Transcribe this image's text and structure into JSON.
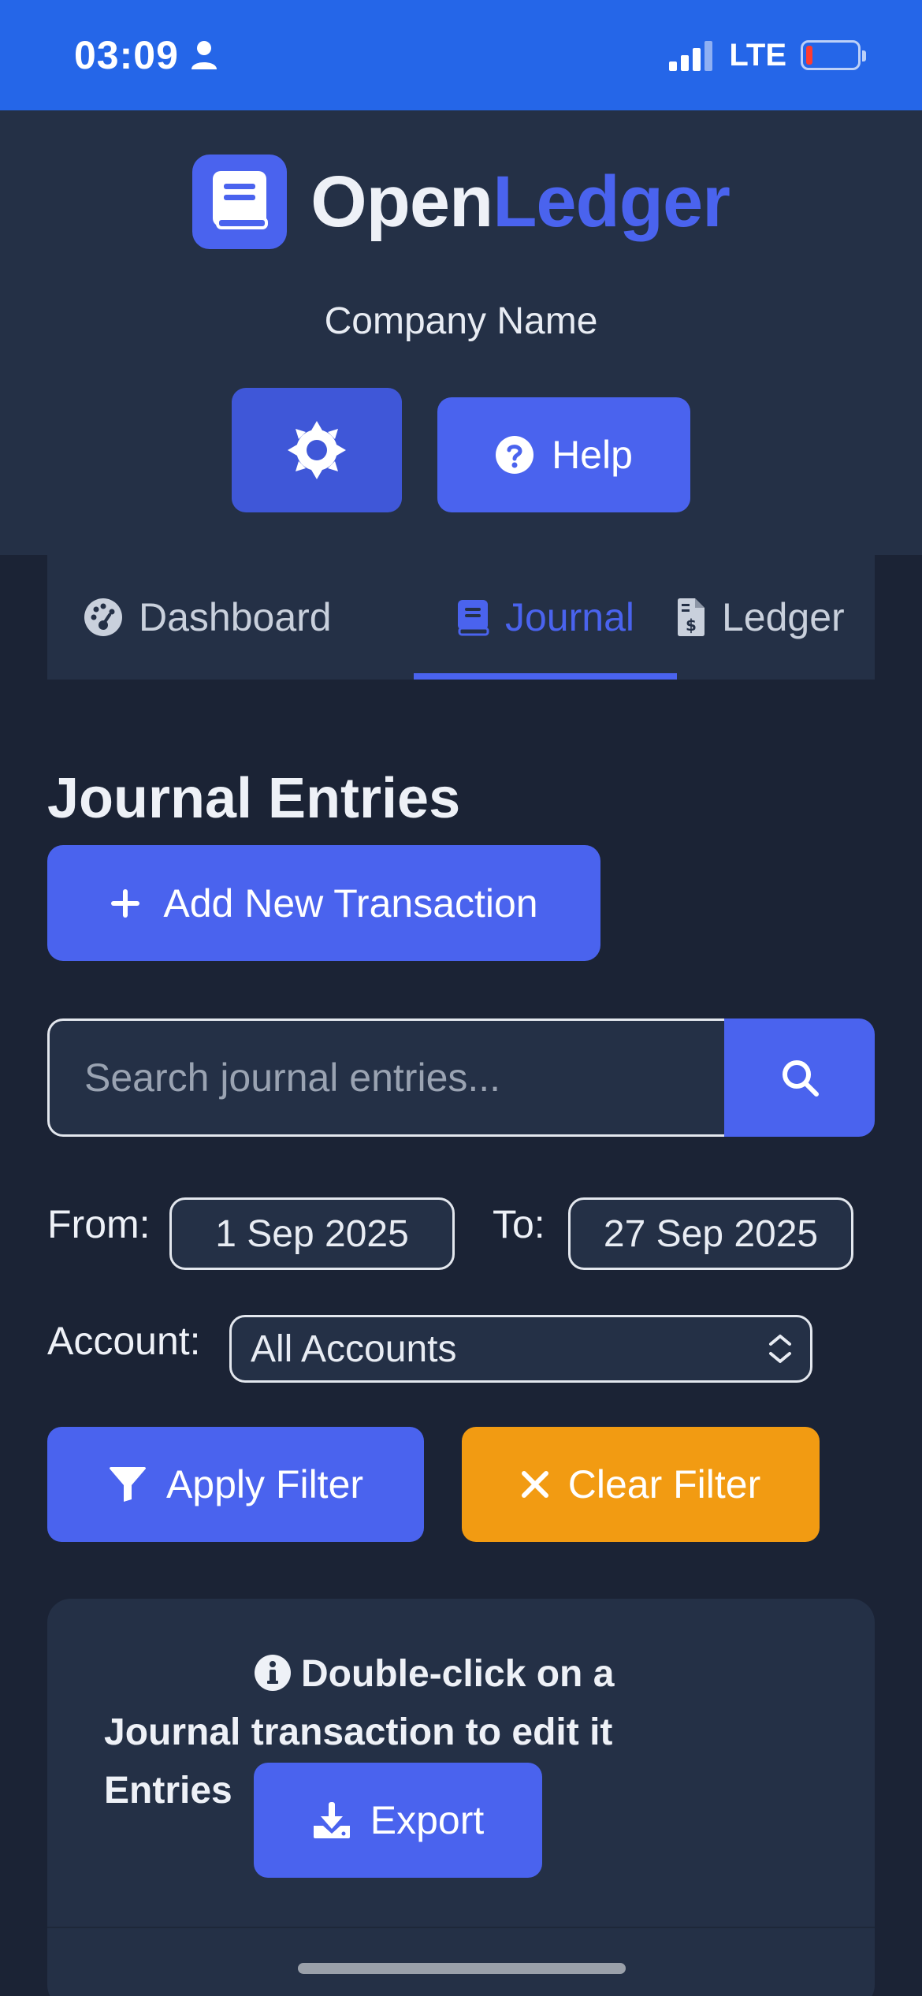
{
  "status_bar": {
    "time": "03:09",
    "network": "LTE",
    "icons": [
      "person-icon",
      "signal-icon",
      "battery-low-icon"
    ]
  },
  "header": {
    "brand_part1": "Open",
    "brand_part2": "Ledger",
    "company_name": "Company Name",
    "help_label": "Help",
    "icons": [
      "book-icon",
      "gear-icon",
      "question-circle-icon"
    ]
  },
  "tabs": [
    {
      "label": "Dashboard",
      "icon": "gauge-icon",
      "active": false
    },
    {
      "label": "Journal",
      "icon": "book-icon",
      "active": true
    },
    {
      "label": "Ledger",
      "icon": "invoice-dollar-icon",
      "active": false
    }
  ],
  "main": {
    "title": "Journal Entries",
    "add_button": "Add New Transaction",
    "search_placeholder": "Search journal entries...",
    "from_label": "From:",
    "from_date": "1 Sep 2025",
    "to_label": "To:",
    "to_date": "27 Sep 2025",
    "account_label": "Account:",
    "account_value": "All Accounts",
    "apply_filter": "Apply Filter",
    "clear_filter": "Clear Filter"
  },
  "card": {
    "hint_line1": "Double-click on a",
    "hint_line2": "Journal transaction to edit it",
    "hint_line3": "Entries",
    "export_label": "Export"
  },
  "colors": {
    "status_bar": "#2566e8",
    "header_bg": "#243046",
    "page_bg": "#1b2335",
    "accent": "#4a63ee",
    "warning": "#f29b12"
  }
}
